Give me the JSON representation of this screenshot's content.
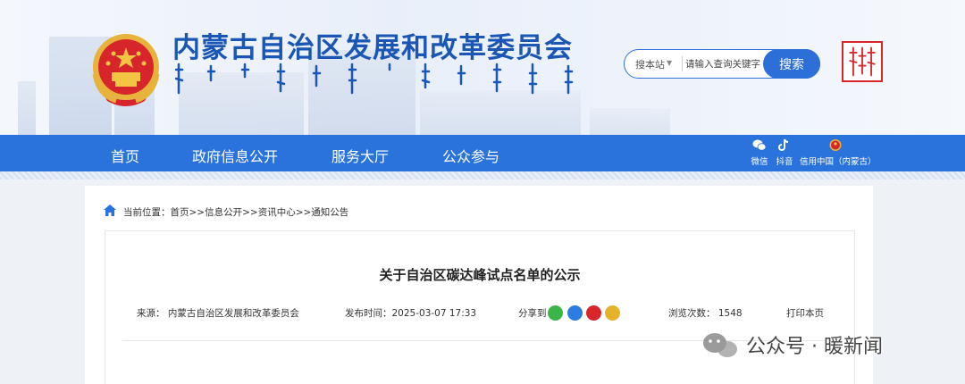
{
  "header": {
    "site_title": "内蒙古自治区发展和改革委员会",
    "search_scope": "搜本站",
    "search_placeholder": "请输入查询关键字",
    "search_button": "搜索"
  },
  "nav": {
    "items": [
      "首页",
      "政府信息公开",
      "服务大厅",
      "公众参与"
    ],
    "social": [
      {
        "label": "微信",
        "icon": "wechat-icon"
      },
      {
        "label": "抖音",
        "icon": "douyin-icon"
      },
      {
        "label": "信用中国（内蒙古）",
        "icon": "credit-china-icon"
      }
    ]
  },
  "breadcrumb": "当前位置：首页>>信息公开>>资讯中心>>通知公告",
  "article": {
    "title": "关于自治区碳达峰试点名单的公示",
    "source": "来源：  内蒙古自治区发展和改革委员会",
    "date": "发布时间：2025-03-07 17:33",
    "share_label": "分享到",
    "views": "浏览次数：  1548",
    "print": "打印本页"
  },
  "watermark": "公众号 · 暖新闻",
  "colors": {
    "brand_blue": "#2a73dc",
    "title_blue": "#1a56b4",
    "seal_red": "#d9262b"
  }
}
